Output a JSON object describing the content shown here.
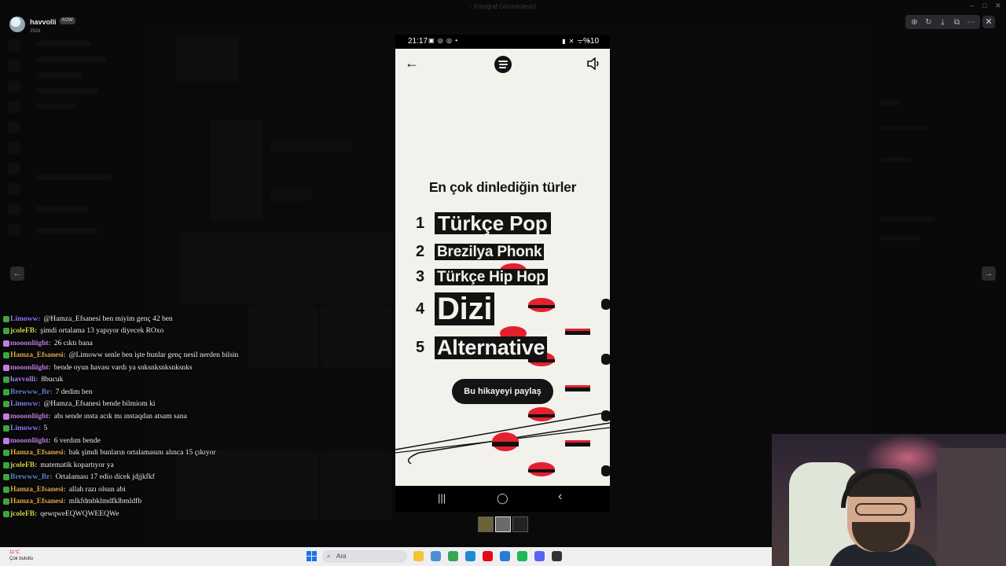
{
  "window": {
    "title": "- Fotoğraf Görüntüleyici"
  },
  "viewer": {
    "user": {
      "name": "havvolli",
      "badge": "AOW",
      "sub": "2524"
    },
    "tools": [
      {
        "icon": "zoom-in-icon",
        "glyph": "⊕"
      },
      {
        "icon": "rotate-icon",
        "glyph": "↻"
      },
      {
        "icon": "download-icon",
        "glyph": "⤓"
      },
      {
        "icon": "open-external-icon",
        "glyph": "⧉"
      },
      {
        "icon": "more-icon",
        "glyph": "⋯"
      }
    ],
    "close_glyph": "✕",
    "prev_glyph": "←",
    "next_glyph": "→"
  },
  "phone": {
    "status": {
      "time": "21:17",
      "left_icons": "▣ ◎ ◎ •",
      "right_icons": "▮ ✕ ᯤ ◔",
      "battery": "%10"
    },
    "back_glyph": "←",
    "title": "En çok dinlediğin türler",
    "genres": [
      {
        "rank": "1",
        "name": "Türkçe Pop"
      },
      {
        "rank": "2",
        "name": "Brezilya Phonk"
      },
      {
        "rank": "3",
        "name": "Türkçe Hip Hop"
      },
      {
        "rank": "4",
        "name": "Dizi"
      },
      {
        "rank": "5",
        "name": "Alternative"
      }
    ],
    "share_button": "Bu hikayeyi paylaş",
    "nav": {
      "recent": "|||",
      "home": "◯",
      "back": "‹"
    },
    "accent_red": "#e5202e"
  },
  "chat": [
    {
      "user": "Limoww",
      "color": "#8a7cff",
      "badge": "#3ea43e",
      "text": "@Hamza_Efsanesi ben miyim genç 42 ben"
    },
    {
      "user": "jcoleFB",
      "color": "#d2d64a",
      "badge": "#3ea43e",
      "text": "şimdi ortalama 13 yapıyor diyecek ROxo"
    },
    {
      "user": "mooonliight",
      "color": "#c07fe0",
      "badge": "#c07fe0",
      "text": "26 cıktı bana"
    },
    {
      "user": "Hamza_Efsanesi",
      "color": "#e0a84e",
      "badge": "#3ea43e",
      "text": "@Limoww senle ben işte bunlar genç nesil nerden bilsin"
    },
    {
      "user": "mooonliight",
      "color": "#c07fe0",
      "badge": "#c07fe0",
      "text": "bende oyun havası vardı ya snksnksnksnksnks"
    },
    {
      "user": "havvolli",
      "color": "#b07cff",
      "badge": "#3ea43e",
      "text": "8bucuk"
    },
    {
      "user": "Brewww_Br",
      "color": "#5b86d6",
      "badge": "#3ea43e",
      "text": "7 dedim ben"
    },
    {
      "user": "Limoww",
      "color": "#8a7cff",
      "badge": "#3ea43e",
      "text": "@Hamza_Efsanesi bende bilmiom ki"
    },
    {
      "user": "mooonliight",
      "color": "#c07fe0",
      "badge": "#c07fe0",
      "text": "abı sende ınsta acık mı ınstaqdan atsam sana"
    },
    {
      "user": "Limoww",
      "color": "#8a7cff",
      "badge": "#3ea43e",
      "text": "5"
    },
    {
      "user": "mooonliight",
      "color": "#c07fe0",
      "badge": "#c07fe0",
      "text": "6 verdım bende"
    },
    {
      "user": "Hamza_Efsanesi",
      "color": "#e0a84e",
      "badge": "#3ea43e",
      "text": "bak şimdi bunların ortalamasını alınca 15 çıkıyor"
    },
    {
      "user": "jcoleFB",
      "color": "#d2d64a",
      "badge": "#3ea43e",
      "text": "matematik kopartıyor ya"
    },
    {
      "user": "Brewww_Br",
      "color": "#5b86d6",
      "badge": "#3ea43e",
      "text": "Ortalaması 17 edio dicek jdjjkfkf"
    },
    {
      "user": "Hamza_Efsanesi",
      "color": "#e0a84e",
      "badge": "#3ea43e",
      "text": "allah razı olsun abi"
    },
    {
      "user": "Hamza_Efsanesi",
      "color": "#e0a84e",
      "badge": "#3ea43e",
      "text": "mlkfdmbklmdfklbmldfb"
    },
    {
      "user": "jcoleFB",
      "color": "#d2d64a",
      "badge": "#3ea43e",
      "text": "qewqweEQWQWEEQWe"
    }
  ],
  "taskbar": {
    "weather_temp": "11°C",
    "weather_desc": "Çok bulutlu",
    "search_placeholder": "Ara",
    "search_icon": "search-icon",
    "apps": [
      {
        "name": "file-explorer-icon",
        "color": "#f4c430"
      },
      {
        "name": "photos-icon",
        "color": "#4a90d9"
      },
      {
        "name": "chrome-icon",
        "color": "#34a853"
      },
      {
        "name": "edge-icon",
        "color": "#1f8ad2"
      },
      {
        "name": "netflix-icon",
        "color": "#e50914"
      },
      {
        "name": "store-icon",
        "color": "#2b7bd6"
      },
      {
        "name": "spotify-icon",
        "color": "#1db954"
      },
      {
        "name": "discord-icon",
        "color": "#5865f2"
      },
      {
        "name": "obs-icon",
        "color": "#333333"
      }
    ]
  }
}
